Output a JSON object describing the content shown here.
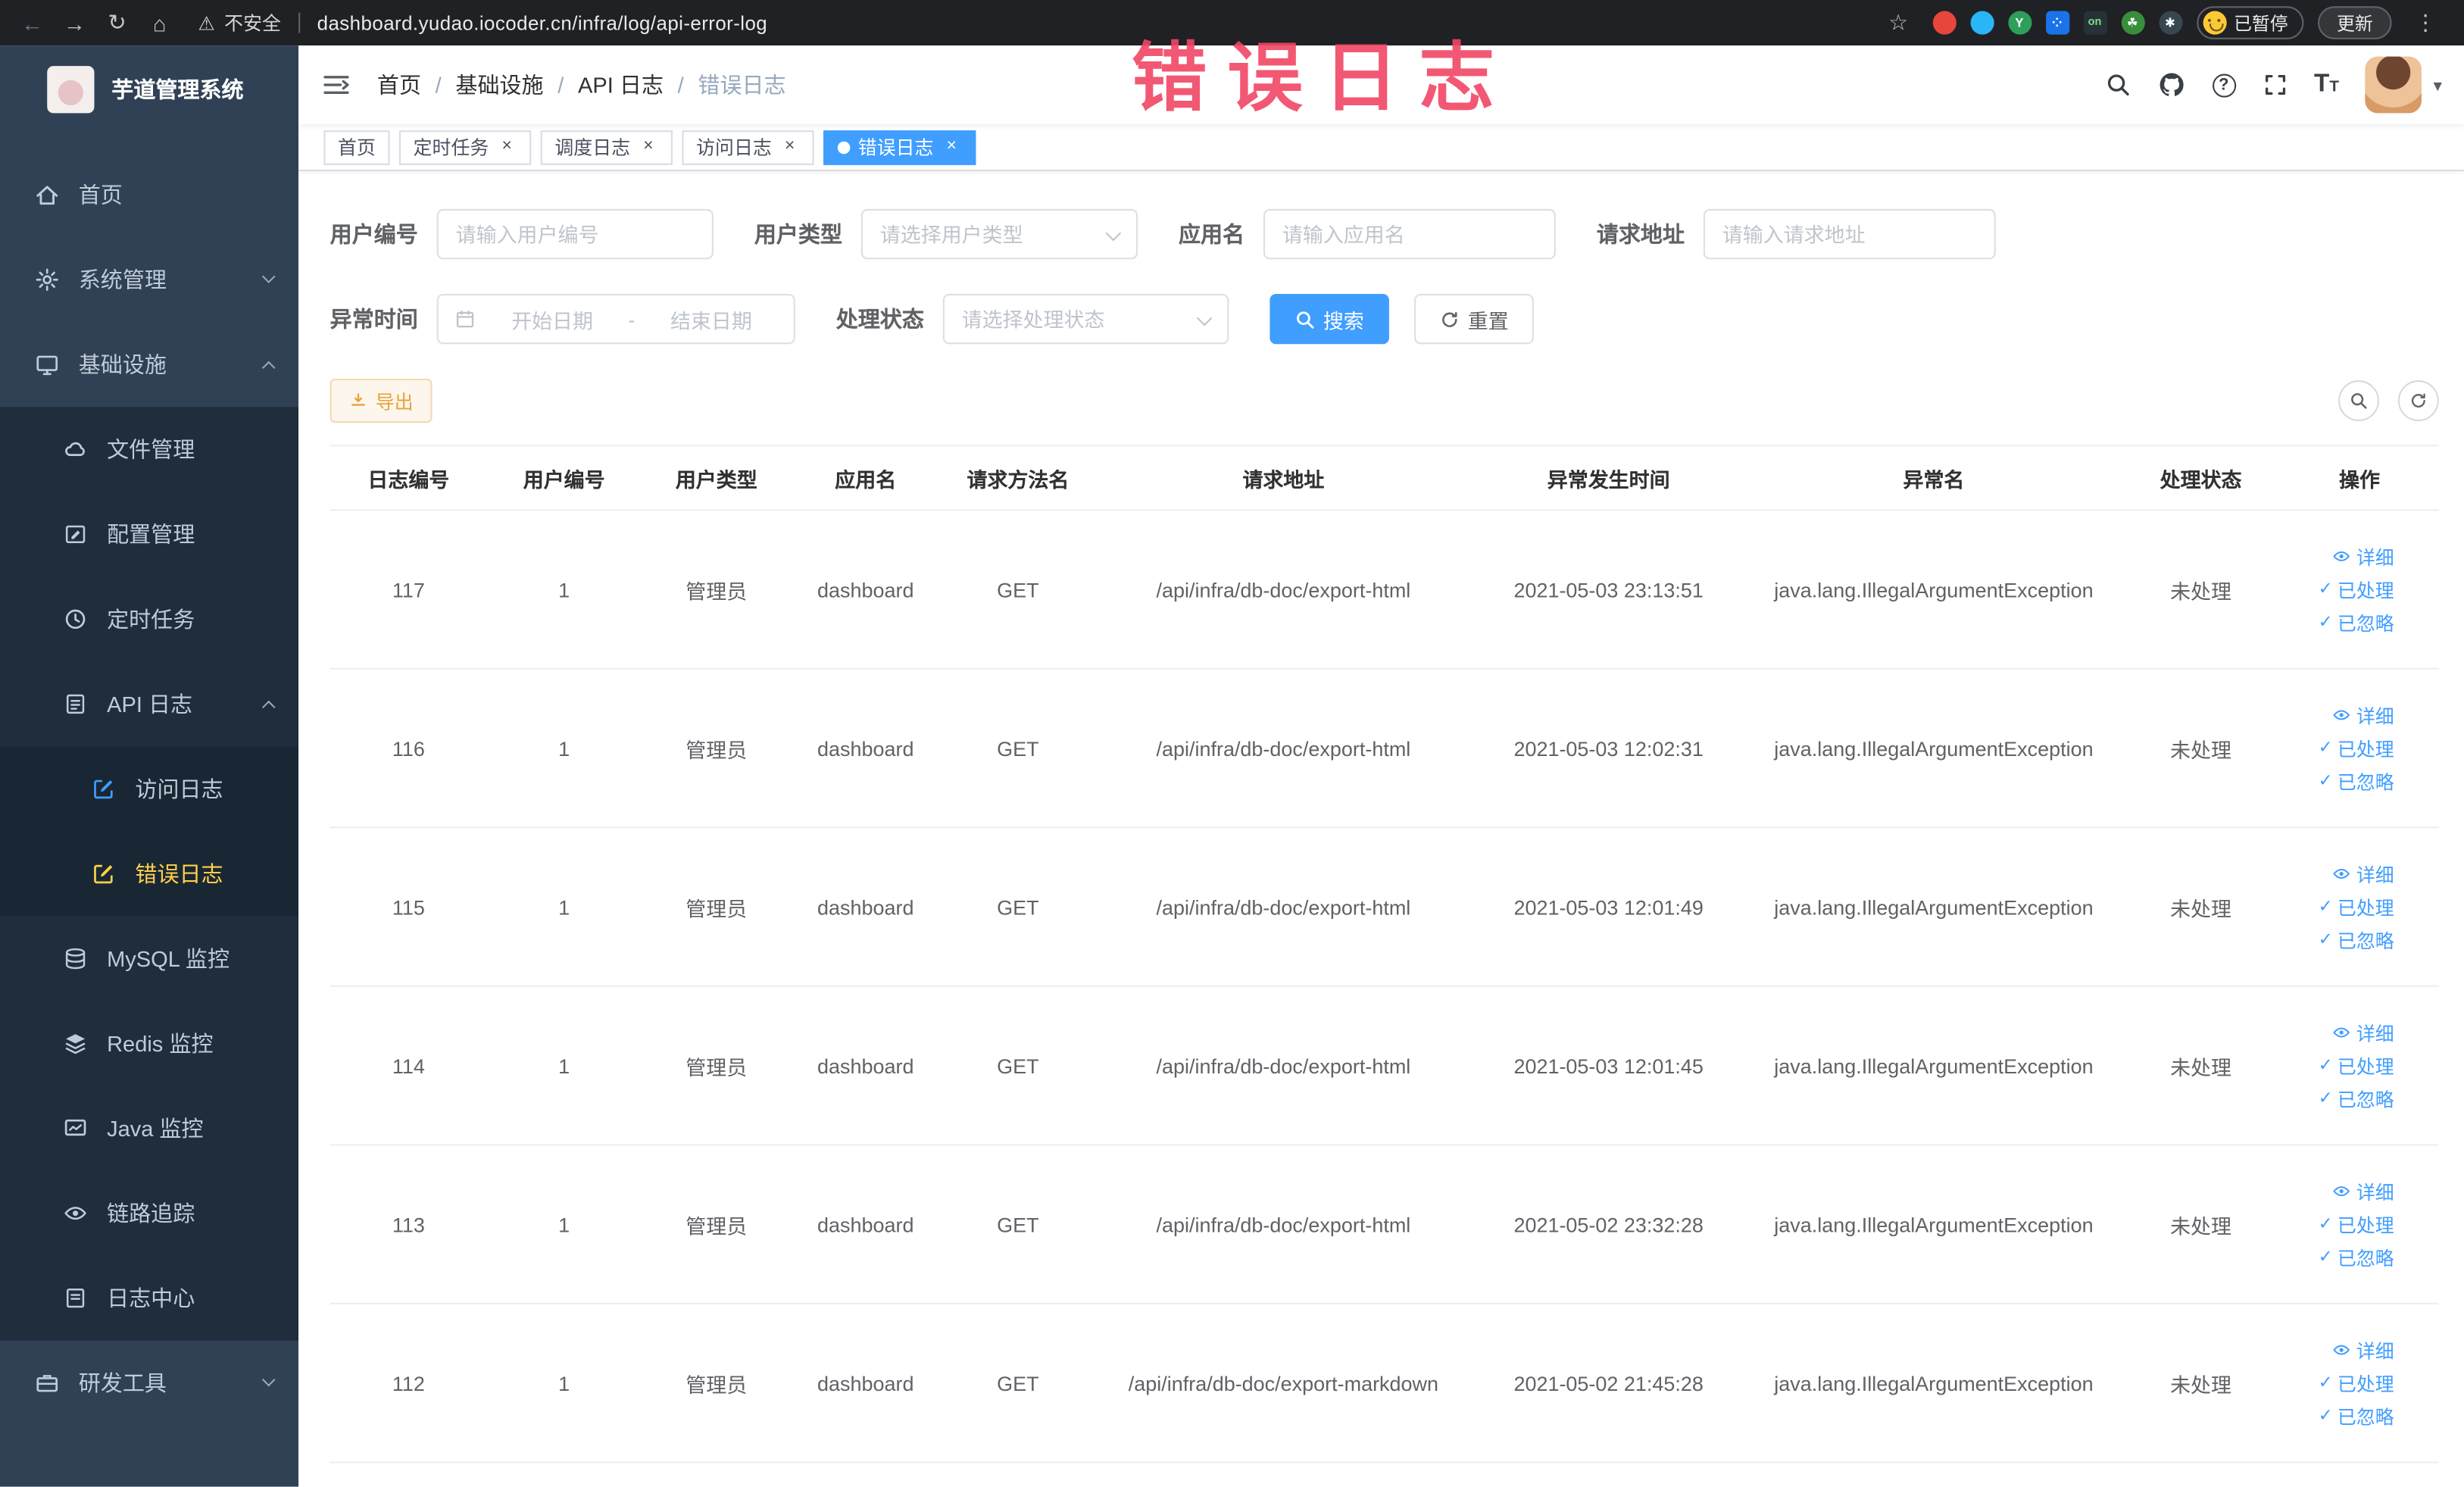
{
  "colors": {
    "accent_blue": "#409EFF",
    "warning_orange": "#E6A23C",
    "sidebar_bg": "#304156",
    "sidebar_submenu_bg": "#1f2d3d",
    "sidebar_active_text": "#ffd04b",
    "tab_active_bg": "#409EFF",
    "annotation_red": "#F14664",
    "browser_bar_bg": "#202124"
  },
  "browser": {
    "back_icon": "←",
    "forward_icon": "→",
    "reload_icon": "↻",
    "home_icon": "⌂",
    "warning_icon": "⚠",
    "security_label": "不安全",
    "url": "dashboard.yudao.iocoder.cn/infra/log/api-error-log",
    "star_icon": "☆",
    "profile_badge": "已暂停",
    "update_button": "更新",
    "menu_icon": "⋮"
  },
  "annotation": {
    "text": "错误日志"
  },
  "sidebar": {
    "logo_title": "芋道管理系统",
    "items": [
      {
        "label": "首页"
      },
      {
        "label": "系统管理"
      },
      {
        "label": "基础设施"
      },
      {
        "label": "文件管理"
      },
      {
        "label": "配置管理"
      },
      {
        "label": "定时任务"
      },
      {
        "label": "API 日志"
      },
      {
        "label": "访问日志"
      },
      {
        "label": "错误日志"
      },
      {
        "label": "MySQL 监控"
      },
      {
        "label": "Redis 监控"
      },
      {
        "label": "Java 监控"
      },
      {
        "label": "链路追踪"
      },
      {
        "label": "日志中心"
      },
      {
        "label": "研发工具"
      }
    ]
  },
  "breadcrumb": {
    "items": [
      "首页",
      "基础设施",
      "API 日志",
      "错误日志"
    ],
    "separator": "/"
  },
  "tabs": [
    {
      "label": "首页"
    },
    {
      "label": "定时任务"
    },
    {
      "label": "调度日志"
    },
    {
      "label": "访问日志"
    },
    {
      "label": "错误日志"
    }
  ],
  "filters": {
    "user_id": {
      "label": "用户编号",
      "placeholder": "请输入用户编号"
    },
    "user_type": {
      "label": "用户类型",
      "placeholder": "请选择用户类型"
    },
    "app_name": {
      "label": "应用名",
      "placeholder": "请输入应用名"
    },
    "request_url": {
      "label": "请求地址",
      "placeholder": "请输入请求地址"
    },
    "exception_time": {
      "label": "异常时间",
      "start_placeholder": "开始日期",
      "separator": "-",
      "end_placeholder": "结束日期"
    },
    "process_status": {
      "label": "处理状态",
      "placeholder": "请选择处理状态"
    },
    "search_button": "搜索",
    "reset_button": "重置"
  },
  "toolbar": {
    "export_button": "导出"
  },
  "table": {
    "headers": [
      "日志编号",
      "用户编号",
      "用户类型",
      "应用名",
      "请求方法名",
      "请求地址",
      "异常发生时间",
      "异常名",
      "处理状态",
      "操作"
    ],
    "actions": {
      "detail": "详细",
      "processed": "已处理",
      "ignored": "已忽略"
    },
    "rows": [
      {
        "id": "117",
        "user_id": "1",
        "user_type": "管理员",
        "app": "dashboard",
        "method": "GET",
        "url": "/api/infra/db-doc/export-html",
        "time": "2021-05-03 23:13:51",
        "exception": "java.lang.IllegalArgumentException",
        "status": "未处理"
      },
      {
        "id": "116",
        "user_id": "1",
        "user_type": "管理员",
        "app": "dashboard",
        "method": "GET",
        "url": "/api/infra/db-doc/export-html",
        "time": "2021-05-03 12:02:31",
        "exception": "java.lang.IllegalArgumentException",
        "status": "未处理"
      },
      {
        "id": "115",
        "user_id": "1",
        "user_type": "管理员",
        "app": "dashboard",
        "method": "GET",
        "url": "/api/infra/db-doc/export-html",
        "time": "2021-05-03 12:01:49",
        "exception": "java.lang.IllegalArgumentException",
        "status": "未处理"
      },
      {
        "id": "114",
        "user_id": "1",
        "user_type": "管理员",
        "app": "dashboard",
        "method": "GET",
        "url": "/api/infra/db-doc/export-html",
        "time": "2021-05-03 12:01:45",
        "exception": "java.lang.IllegalArgumentException",
        "status": "未处理"
      },
      {
        "id": "113",
        "user_id": "1",
        "user_type": "管理员",
        "app": "dashboard",
        "method": "GET",
        "url": "/api/infra/db-doc/export-html",
        "time": "2021-05-02 23:32:28",
        "exception": "java.lang.IllegalArgumentException",
        "status": "未处理"
      },
      {
        "id": "112",
        "user_id": "1",
        "user_type": "管理员",
        "app": "dashboard",
        "method": "GET",
        "url": "/api/infra/db-doc/export-markdown",
        "time": "2021-05-02 21:45:28",
        "exception": "java.lang.IllegalArgumentException",
        "status": "未处理"
      }
    ]
  }
}
